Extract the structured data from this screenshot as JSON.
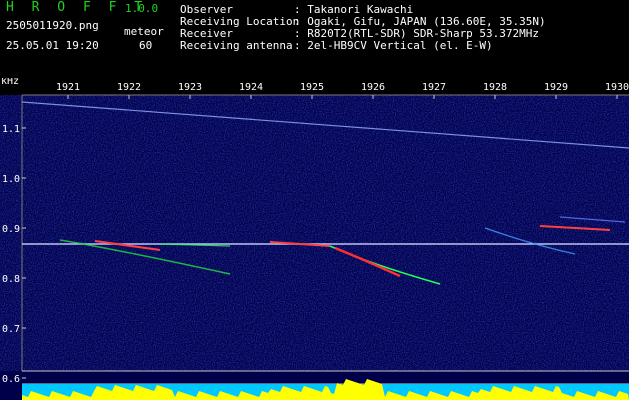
{
  "app": {
    "name": "H R O F F T",
    "version": "1.0.0",
    "filename": "2505011920.png",
    "datetime": "25.05.01 19:20",
    "meteor_label": "meteor",
    "meteor_count": "60"
  },
  "info": {
    "rows": [
      {
        "key": "Observer",
        "value": ": Takanori Kawachi"
      },
      {
        "key": "Receiving Location",
        "value": ": Ogaki, Gifu, JAPAN (136.60E, 35.35N)"
      },
      {
        "key": "Receiver",
        "value": ": R820T2(RTL-SDR) SDR-Sharp 53.372MHz"
      },
      {
        "key": "Receiving antenna",
        "value": ": 2el-HB9CV Vertical (el. E-W)"
      }
    ]
  },
  "spectrogram": {
    "unit_label": "kHz",
    "x_ticks": [
      "1921",
      "1922",
      "1923",
      "1924",
      "1925",
      "1926",
      "1927",
      "1928",
      "1929",
      "1930"
    ],
    "y_ticks": [
      "1.1",
      "1.0",
      "0.9",
      "0.8",
      "0.7",
      "0.6"
    ],
    "colors": {
      "background": "#00004a",
      "signal": "#ffffff",
      "meteor": "#ff3030",
      "trail": "#20ff40",
      "histogram": "#ffff00",
      "baseline": "#00c8ff"
    }
  }
}
